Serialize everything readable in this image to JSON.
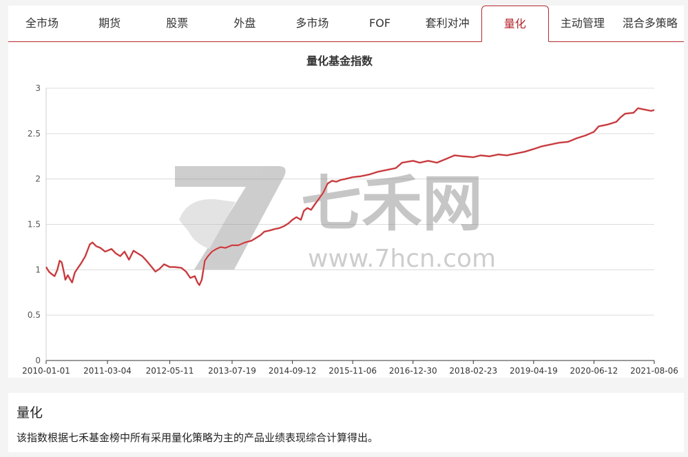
{
  "tabs": [
    {
      "label": "全市场",
      "active": false
    },
    {
      "label": "期货",
      "active": false
    },
    {
      "label": "股票",
      "active": false
    },
    {
      "label": "外盘",
      "active": false
    },
    {
      "label": "多市场",
      "active": false
    },
    {
      "label": "FOF",
      "active": false
    },
    {
      "label": "套利对冲",
      "active": false
    },
    {
      "label": "量化",
      "active": true
    },
    {
      "label": "主动管理",
      "active": false
    },
    {
      "label": "混合多策略",
      "active": false
    }
  ],
  "watermark": {
    "brand": "七禾网",
    "url": "www.7hcn.com"
  },
  "colors": {
    "accent": "#b3272d",
    "line": "#c0292e",
    "grid": "#dcdcdc"
  },
  "info": {
    "title": "量化",
    "description": "该指数根据七禾基金榜中所有采用量化策略为主的产品业绩表现综合计算得出。"
  },
  "chart_data": {
    "type": "line",
    "title": "量化基金指数",
    "xlabel": "",
    "ylabel": "",
    "ylim": [
      0,
      3
    ],
    "yticks": [
      0,
      0.5,
      1,
      1.5,
      2,
      2.5,
      3
    ],
    "xticks": [
      "2010-01-01",
      "2011-03-04",
      "2012-05-11",
      "2013-07-19",
      "2014-09-12",
      "2015-11-06",
      "2016-12-30",
      "2018-02-23",
      "2019-04-19",
      "2020-06-12",
      "2021-08-06"
    ],
    "grid": true,
    "series": [
      {
        "name": "",
        "points": [
          [
            "2010-01-01",
            1.03
          ],
          [
            "2010-01-20",
            0.98
          ],
          [
            "2010-02-10",
            0.95
          ],
          [
            "2010-03-01",
            0.93
          ],
          [
            "2010-03-20",
            1.0
          ],
          [
            "2010-04-05",
            1.1
          ],
          [
            "2010-04-20",
            1.08
          ],
          [
            "2010-05-05",
            0.97
          ],
          [
            "2010-05-15",
            0.89
          ],
          [
            "2010-06-01",
            0.94
          ],
          [
            "2010-06-15",
            0.9
          ],
          [
            "2010-07-01",
            0.86
          ],
          [
            "2010-07-20",
            0.97
          ],
          [
            "2010-08-10",
            1.02
          ],
          [
            "2010-09-01",
            1.07
          ],
          [
            "2010-10-01",
            1.15
          ],
          [
            "2010-11-01",
            1.28
          ],
          [
            "2010-11-20",
            1.3
          ],
          [
            "2010-12-15",
            1.26
          ],
          [
            "2011-01-15",
            1.24
          ],
          [
            "2011-02-15",
            1.2
          ],
          [
            "2011-03-04",
            1.21
          ],
          [
            "2011-04-01",
            1.23
          ],
          [
            "2011-05-01",
            1.18
          ],
          [
            "2011-06-01",
            1.15
          ],
          [
            "2011-07-01",
            1.2
          ],
          [
            "2011-08-01",
            1.11
          ],
          [
            "2011-09-01",
            1.21
          ],
          [
            "2011-10-01",
            1.18
          ],
          [
            "2011-11-01",
            1.15
          ],
          [
            "2011-12-01",
            1.1
          ],
          [
            "2012-01-01",
            1.04
          ],
          [
            "2012-02-01",
            0.98
          ],
          [
            "2012-03-01",
            1.01
          ],
          [
            "2012-04-01",
            1.06
          ],
          [
            "2012-05-11",
            1.03
          ],
          [
            "2012-06-15",
            1.03
          ],
          [
            "2012-08-01",
            1.02
          ],
          [
            "2012-09-01",
            0.98
          ],
          [
            "2012-10-01",
            0.91
          ],
          [
            "2012-11-01",
            0.93
          ],
          [
            "2012-11-20",
            0.86
          ],
          [
            "2012-12-03",
            0.83
          ],
          [
            "2012-12-20",
            0.89
          ],
          [
            "2013-01-10",
            1.1
          ],
          [
            "2013-02-01",
            1.15
          ],
          [
            "2013-03-01",
            1.2
          ],
          [
            "2013-04-01",
            1.23
          ],
          [
            "2013-05-01",
            1.25
          ],
          [
            "2013-06-01",
            1.24
          ],
          [
            "2013-07-19",
            1.27
          ],
          [
            "2013-09-01",
            1.27
          ],
          [
            "2013-10-15",
            1.3
          ],
          [
            "2013-12-01",
            1.32
          ],
          [
            "2014-01-01",
            1.35
          ],
          [
            "2014-02-01",
            1.38
          ],
          [
            "2014-03-01",
            1.42
          ],
          [
            "2014-04-01",
            1.43
          ],
          [
            "2014-05-15",
            1.45
          ],
          [
            "2014-06-15",
            1.46
          ],
          [
            "2014-07-15",
            1.48
          ],
          [
            "2014-08-15",
            1.51
          ],
          [
            "2014-09-12",
            1.55
          ],
          [
            "2014-10-10",
            1.58
          ],
          [
            "2014-11-10",
            1.55
          ],
          [
            "2014-12-01",
            1.65
          ],
          [
            "2014-12-25",
            1.68
          ],
          [
            "2015-01-20",
            1.66
          ],
          [
            "2015-02-15",
            1.72
          ],
          [
            "2015-03-15",
            1.78
          ],
          [
            "2015-04-15",
            1.85
          ],
          [
            "2015-05-15",
            1.95
          ],
          [
            "2015-06-15",
            1.98
          ],
          [
            "2015-07-15",
            1.97
          ],
          [
            "2015-08-15",
            1.99
          ],
          [
            "2015-09-15",
            2.0
          ],
          [
            "2015-11-06",
            2.02
          ],
          [
            "2016-01-01",
            2.03
          ],
          [
            "2016-03-01",
            2.05
          ],
          [
            "2016-05-01",
            2.08
          ],
          [
            "2016-07-01",
            2.1
          ],
          [
            "2016-09-01",
            2.12
          ],
          [
            "2016-10-15",
            2.18
          ],
          [
            "2016-12-30",
            2.2
          ],
          [
            "2017-02-15",
            2.18
          ],
          [
            "2017-04-15",
            2.2
          ],
          [
            "2017-06-15",
            2.18
          ],
          [
            "2017-08-15",
            2.22
          ],
          [
            "2017-10-15",
            2.26
          ],
          [
            "2017-12-15",
            2.25
          ],
          [
            "2018-02-23",
            2.24
          ],
          [
            "2018-04-15",
            2.26
          ],
          [
            "2018-06-15",
            2.25
          ],
          [
            "2018-08-15",
            2.27
          ],
          [
            "2018-10-15",
            2.26
          ],
          [
            "2018-12-15",
            2.28
          ],
          [
            "2019-02-15",
            2.3
          ],
          [
            "2019-04-19",
            2.33
          ],
          [
            "2019-06-15",
            2.36
          ],
          [
            "2019-08-15",
            2.38
          ],
          [
            "2019-10-15",
            2.4
          ],
          [
            "2019-12-15",
            2.41
          ],
          [
            "2020-02-15",
            2.45
          ],
          [
            "2020-04-15",
            2.48
          ],
          [
            "2020-06-12",
            2.52
          ],
          [
            "2020-07-15",
            2.58
          ],
          [
            "2020-09-15",
            2.6
          ],
          [
            "2020-11-15",
            2.63
          ],
          [
            "2020-12-15",
            2.68
          ],
          [
            "2021-01-15",
            2.72
          ],
          [
            "2021-03-15",
            2.73
          ],
          [
            "2021-04-15",
            2.78
          ],
          [
            "2021-05-15",
            2.77
          ],
          [
            "2021-06-15",
            2.76
          ],
          [
            "2021-07-15",
            2.75
          ],
          [
            "2021-08-06",
            2.76
          ]
        ]
      }
    ]
  }
}
